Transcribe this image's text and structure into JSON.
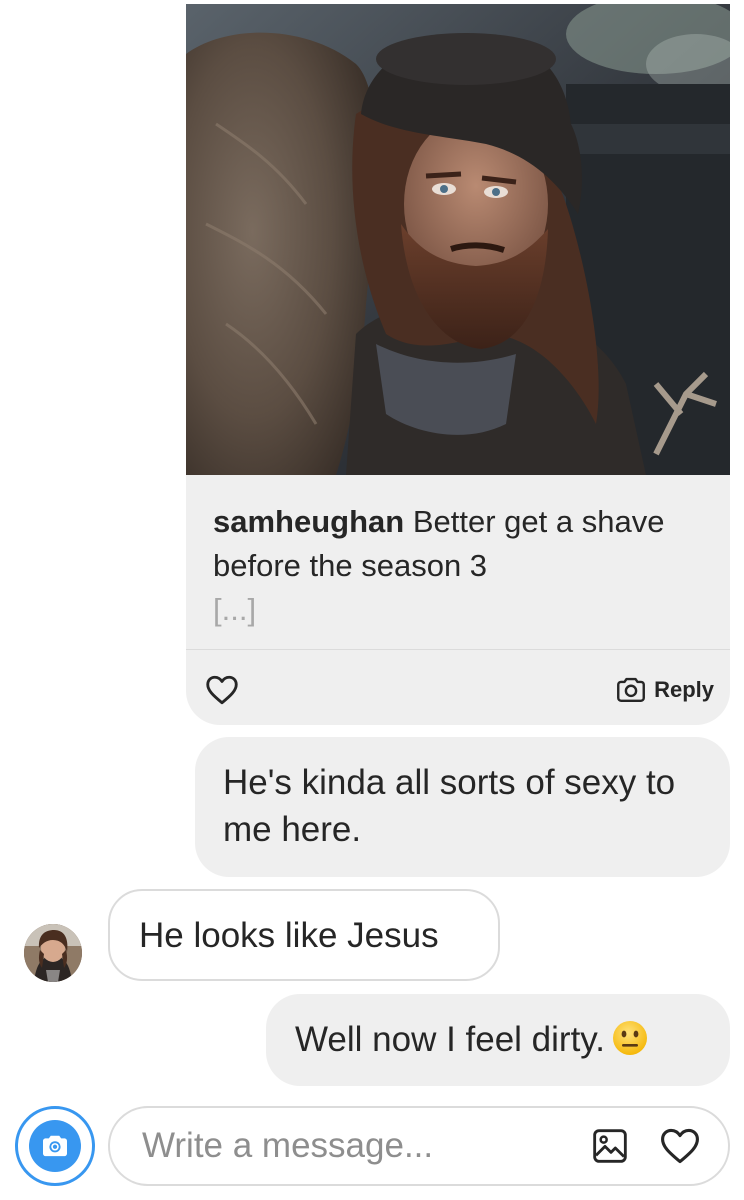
{
  "shared_post": {
    "username": "samheughan",
    "caption": "Better get a shave before the season 3",
    "more": "[...]",
    "image_alt": "photo-of-bearded-man-in-flat-cap",
    "like_icon": "heart-outline-icon",
    "reply_icon": "camera-icon",
    "reply_label": "Reply"
  },
  "messages": [
    {
      "direction": "outgoing",
      "text": "He's kinda all sorts of sexy to me here."
    },
    {
      "direction": "incoming",
      "text": "He looks like Jesus"
    },
    {
      "direction": "outgoing",
      "text": "Well now I feel dirty.",
      "emoji": "neutral-face-emoji"
    }
  ],
  "composer": {
    "camera_icon": "camera-icon",
    "placeholder": "Write a message...",
    "gallery_icon": "image-icon",
    "like_icon": "heart-outline-icon"
  },
  "colors": {
    "accent": "#3897f0",
    "bubble_gray": "#efefef",
    "border": "#dbdbdb",
    "placeholder": "#8e8e8e",
    "text": "#262626"
  }
}
